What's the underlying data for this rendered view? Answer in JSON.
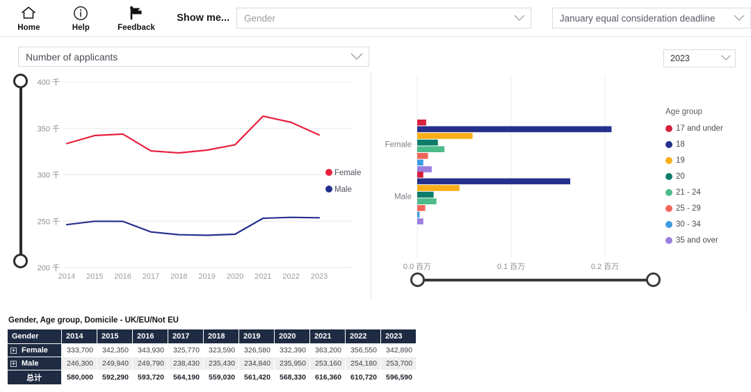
{
  "toolbar": {
    "buttons": [
      {
        "label": "Home",
        "icon": "home-icon"
      },
      {
        "label": "Help",
        "icon": "info-circle-icon"
      },
      {
        "label": "Feedback",
        "icon": "megaphone-icon"
      }
    ],
    "show_me_label": "Show me...",
    "show_me_value": "Gender",
    "show_me_placeholder": "Gender",
    "deadline_value": "January equal consideration deadline"
  },
  "controls": {
    "measure_value": "Number of applicants",
    "year_value": "2023"
  },
  "chart_data": [
    {
      "type": "line",
      "title": "",
      "xlabel": "",
      "ylabel": "",
      "x": [
        "2014",
        "2015",
        "2016",
        "2017",
        "2018",
        "2019",
        "2020",
        "2021",
        "2022",
        "2023"
      ],
      "ytick_labels": [
        "200 千",
        "250 千",
        "300 千",
        "350 千",
        "400 千"
      ],
      "ytick_values": [
        200000,
        250000,
        300000,
        350000,
        400000
      ],
      "ylim": [
        200000,
        400000
      ],
      "grid": true,
      "legend_position": "right",
      "series": [
        {
          "name": "Female",
          "color": "#E8203C",
          "values": [
            333700,
            342350,
            343930,
            325770,
            323590,
            326580,
            332390,
            363200,
            356550,
            342890
          ]
        },
        {
          "name": "Male",
          "color": "#25308C",
          "values": [
            246300,
            249940,
            249790,
            238430,
            235430,
            234840,
            235950,
            253160,
            254180,
            253700
          ]
        }
      ]
    },
    {
      "type": "bar",
      "orientation": "horizontal",
      "title": "",
      "xlabel": "",
      "ylabel": "",
      "categories": [
        "Female",
        "Male"
      ],
      "xtick_labels": [
        "0.0 百万",
        "0.1 百万",
        "0.2 百万"
      ],
      "xtick_values": [
        0,
        100000,
        200000
      ],
      "xlim": [
        0,
        250000
      ],
      "grid": true,
      "legend_title": "Age group",
      "legend_position": "right",
      "series": [
        {
          "name": "17 and under",
          "color": "#D6203C",
          "values": [
            9500,
            6500
          ]
        },
        {
          "name": "18",
          "color": "#25308C",
          "values": [
            207000,
            163000
          ]
        },
        {
          "name": "19",
          "color": "#F9AE18",
          "values": [
            59000,
            45000
          ]
        },
        {
          "name": "20",
          "color": "#0E7C6B",
          "values": [
            22000,
            17500
          ]
        },
        {
          "name": "21 - 24",
          "color": "#4CBB8A",
          "values": [
            29000,
            20500
          ]
        },
        {
          "name": "25 - 29",
          "color": "#F2655A",
          "values": [
            11500,
            8500
          ]
        },
        {
          "name": "30 - 34",
          "color": "#3D9BE0",
          "values": [
            6500,
            2500
          ]
        },
        {
          "name": "35 and over",
          "color": "#9B7FE0",
          "values": [
            15500,
            6500
          ]
        }
      ]
    }
  ],
  "table": {
    "title": "Gender, Age group, Domicile - UK/EU/Not EU",
    "columns": [
      "Gender",
      "2014",
      "2015",
      "2016",
      "2017",
      "2018",
      "2019",
      "2020",
      "2021",
      "2022",
      "2023"
    ],
    "rows": [
      {
        "label": "Female",
        "expandable": true,
        "total": false,
        "values": [
          "333,700",
          "342,350",
          "343,930",
          "325,770",
          "323,590",
          "326,580",
          "332,390",
          "363,200",
          "356,550",
          "342,890"
        ]
      },
      {
        "label": "Male",
        "expandable": true,
        "total": false,
        "values": [
          "246,300",
          "249,940",
          "249,790",
          "238,430",
          "235,430",
          "234,840",
          "235,950",
          "253,160",
          "254,180",
          "253,700"
        ]
      },
      {
        "label": "总计",
        "expandable": false,
        "total": true,
        "values": [
          "580,000",
          "592,290",
          "593,720",
          "564,190",
          "559,030",
          "561,420",
          "568,330",
          "616,360",
          "610,720",
          "596,590"
        ]
      }
    ],
    "expander_glyph": "+"
  }
}
